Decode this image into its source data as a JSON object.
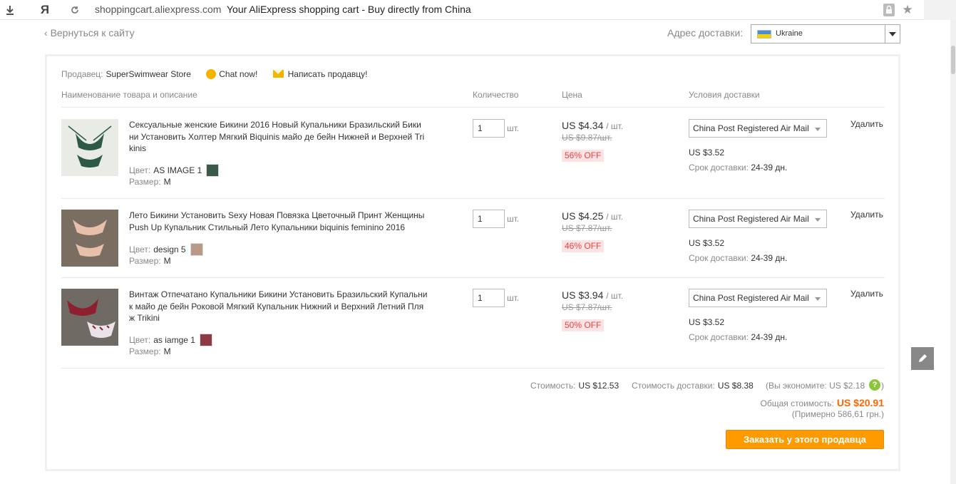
{
  "browser": {
    "download_icon": "download-arrow-icon",
    "logo": "Я",
    "url": "shoppingcart.aliexpress.com",
    "title": "Your AliExpress shopping cart - Buy directly from China"
  },
  "header": {
    "back_link": "Вернуться к сайту",
    "delivery_label": "Адрес доставки:",
    "country": "Ukraine"
  },
  "seller": {
    "label": "Продавец:",
    "name": "SuperSwimwear Store",
    "chat": "Chat now!",
    "message": "Написать продавцу!"
  },
  "columns": {
    "product": "Наименование товара и описание",
    "quantity": "Количество",
    "price": "Цена",
    "shipping": "Условия доставки"
  },
  "items": [
    {
      "title": "Сексуальные женские Бикини 2016 Новый Купальники Бразильский Бики ни Установить Холтер Мягкий Biquinis майо де бейн Нижней и Верхней Tri kinis",
      "color_label": "Цвет:",
      "color": "AS IMAGE 1",
      "size_label": "Размер:",
      "size": "M",
      "qty": "1",
      "unit": "шт.",
      "price": "US $4.34",
      "per": "/ шт.",
      "old_price": "US $9.87/шт.",
      "discount": "56% OFF",
      "shipping_method": "China Post Registered Air Mail",
      "shipping_cost": "US $3.52",
      "delivery_label": "Срок доставки:",
      "delivery_time": "24-39 дн.",
      "delete": "Удалить"
    },
    {
      "title": "Лето Бикини Установить Sexy Новая Повязка Цветочный Принт Женщины Push Up Купальник Стильный Лето Купальники biquinis feminino 2016",
      "color_label": "Цвет:",
      "color": "design 5",
      "size_label": "Размер:",
      "size": "M",
      "qty": "1",
      "unit": "шт.",
      "price": "US $4.25",
      "per": "/ шт.",
      "old_price": "US $7.87/шт.",
      "discount": "46% OFF",
      "shipping_method": "China Post Registered Air Mail",
      "shipping_cost": "US $3.52",
      "delivery_label": "Срок доставки:",
      "delivery_time": "24-39 дн.",
      "delete": "Удалить"
    },
    {
      "title": "Винтаж Отпечатано Купальники Бикини Установить Бразильский Купальни к майо де бейн Роковой Мягкий Купальник Нижний и Верхний Летний Пля ж Trikini",
      "color_label": "Цвет:",
      "color": "as iamge 1",
      "size_label": "Размер:",
      "size": "M",
      "qty": "1",
      "unit": "шт.",
      "price": "US $3.94",
      "per": "/ шт.",
      "old_price": "US $7.87/шт.",
      "discount": "50% OFF",
      "shipping_method": "China Post Registered Air Mail",
      "shipping_cost": "US $3.52",
      "delivery_label": "Срок доставки:",
      "delivery_time": "24-39 дн.",
      "delete": "Удалить"
    }
  ],
  "summary": {
    "cost_label": "Стоимость:",
    "cost": "US $12.53",
    "shipping_label": "Стоимость доставки:",
    "shipping": "US $8.38",
    "save_label": "(Вы экономите:",
    "save": "US $2.18",
    "help": "?",
    "save_close": ")",
    "total_label": "Общая стоимость:",
    "total": "US $20.91",
    "approx": "(Примерно 586,61 грн.)",
    "order_button": "Заказать у этого продавца"
  },
  "colors": {
    "accent": "#ff9a00",
    "total": "#ff6600",
    "discount_bg": "#fde3e3",
    "discount_text": "#e64545"
  }
}
